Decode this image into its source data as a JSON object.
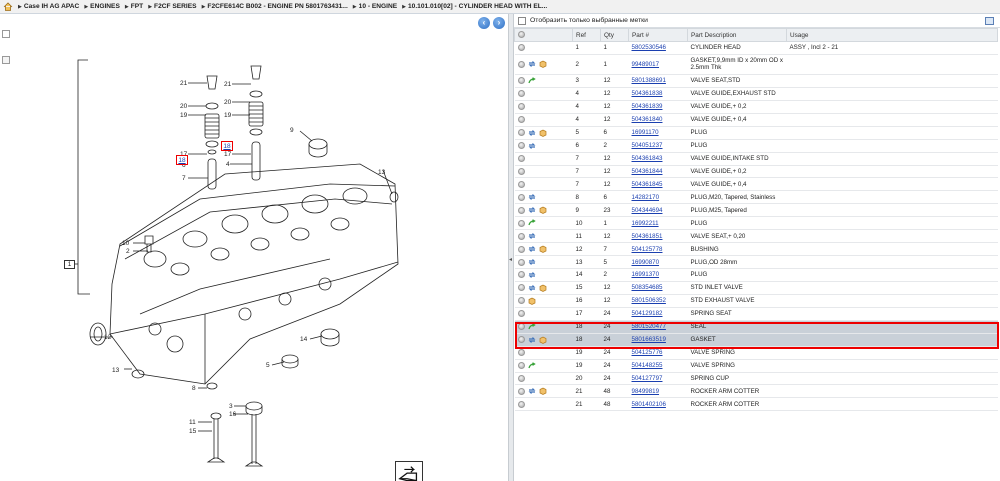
{
  "breadcrumb": {
    "items": [
      "Case IH AG APAC",
      "ENGINES",
      "FPT",
      "F2CF SERIES",
      "F2CFE614C B002 - ENGINE PN 5801763431...",
      "10 - ENGINE",
      "10.101.010[02] - CYLINDER HEAD WITH EL..."
    ]
  },
  "diagram": {
    "highlighted_callouts": [
      "18",
      "18"
    ],
    "group_label": "1",
    "callouts": [
      "21",
      "21",
      "20",
      "19",
      "20",
      "19",
      "17",
      "17",
      "7",
      "4",
      "9",
      "13",
      "14",
      "10",
      "2",
      "8",
      "12",
      "13",
      "5",
      "6",
      "3",
      "16",
      "11",
      "15",
      "14"
    ]
  },
  "parts_panel": {
    "filter_label": "Отобразить только выбранные метки",
    "columns": [
      "",
      "Ref",
      "Qty",
      "Part #",
      "Part Description",
      "Usage"
    ],
    "rows": [
      {
        "icons": [],
        "ref": "1",
        "qty": "1",
        "part": "5802530546",
        "desc": "CYLINDER HEAD",
        "usage": "ASSY , Incl 2 - 21"
      },
      {
        "icons": [
          "swap",
          "box"
        ],
        "ref": "2",
        "qty": "1",
        "part": "99489017",
        "desc": "GASKET,9,9mm ID x 20mm OD x 2.5mm Thk",
        "usage": ""
      },
      {
        "icons": [
          "arrow"
        ],
        "ref": "3",
        "qty": "12",
        "part": "5801388691",
        "desc": "VALVE SEAT,STD",
        "usage": ""
      },
      {
        "icons": [],
        "ref": "4",
        "qty": "12",
        "part": "504361838",
        "desc": "VALVE GUIDE,EXHAUST STD",
        "usage": ""
      },
      {
        "icons": [],
        "ref": "4",
        "qty": "12",
        "part": "504361839",
        "desc": "VALVE GUIDE,+ 0,2",
        "usage": ""
      },
      {
        "icons": [],
        "ref": "4",
        "qty": "12",
        "part": "504361840",
        "desc": "VALVE GUIDE,+ 0,4",
        "usage": ""
      },
      {
        "icons": [
          "swap",
          "box"
        ],
        "ref": "5",
        "qty": "6",
        "part": "16991170",
        "desc": "PLUG",
        "usage": ""
      },
      {
        "icons": [
          "swap"
        ],
        "ref": "6",
        "qty": "2",
        "part": "504051237",
        "desc": "PLUG",
        "usage": ""
      },
      {
        "icons": [],
        "ref": "7",
        "qty": "12",
        "part": "504361843",
        "desc": "VALVE GUIDE,INTAKE STD",
        "usage": ""
      },
      {
        "icons": [],
        "ref": "7",
        "qty": "12",
        "part": "504361844",
        "desc": "VALVE GUIDE,+ 0,2",
        "usage": ""
      },
      {
        "icons": [],
        "ref": "7",
        "qty": "12",
        "part": "504361845",
        "desc": "VALVE GUIDE,+ 0,4",
        "usage": ""
      },
      {
        "icons": [
          "swap"
        ],
        "ref": "8",
        "qty": "6",
        "part": "14282170",
        "desc": "PLUG,M20, Tapered, Stainless",
        "usage": ""
      },
      {
        "icons": [
          "swap",
          "box"
        ],
        "ref": "9",
        "qty": "23",
        "part": "504344694",
        "desc": "PLUG,M25, Tapered",
        "usage": ""
      },
      {
        "icons": [
          "arrow"
        ],
        "ref": "10",
        "qty": "1",
        "part": "16992211",
        "desc": "PLUG",
        "usage": ""
      },
      {
        "icons": [
          "swap"
        ],
        "ref": "11",
        "qty": "12",
        "part": "504361851",
        "desc": "VALVE SEAT,+ 0,20",
        "usage": ""
      },
      {
        "icons": [
          "swap",
          "box"
        ],
        "ref": "12",
        "qty": "7",
        "part": "504125778",
        "desc": "BUSHING",
        "usage": ""
      },
      {
        "icons": [
          "swap"
        ],
        "ref": "13",
        "qty": "5",
        "part": "16990870",
        "desc": "PLUG,OD 28mm",
        "usage": ""
      },
      {
        "icons": [
          "swap"
        ],
        "ref": "14",
        "qty": "2",
        "part": "16991370",
        "desc": "PLUG",
        "usage": ""
      },
      {
        "icons": [
          "swap",
          "box"
        ],
        "ref": "15",
        "qty": "12",
        "part": "508354685",
        "desc": "STD INLET VALVE",
        "usage": ""
      },
      {
        "icons": [
          "box"
        ],
        "ref": "16",
        "qty": "12",
        "part": "5801506352",
        "desc": "STD EXHAUST VALVE",
        "usage": ""
      },
      {
        "icons": [],
        "ref": "17",
        "qty": "24",
        "part": "504129182",
        "desc": "SPRING SEAT",
        "usage": ""
      },
      {
        "icons": [
          "arrow"
        ],
        "ref": "18",
        "qty": "24",
        "part": "5801520477",
        "desc": "SEAL",
        "usage": "",
        "selected": true
      },
      {
        "icons": [
          "swap",
          "box"
        ],
        "ref": "18",
        "qty": "24",
        "part": "5801663519",
        "desc": "GASKET",
        "usage": "",
        "selected": true
      },
      {
        "icons": [],
        "ref": "19",
        "qty": "24",
        "part": "504125776",
        "desc": "VALVE SPRING",
        "usage": ""
      },
      {
        "icons": [
          "arrow"
        ],
        "ref": "19",
        "qty": "24",
        "part": "504148255",
        "desc": "VALVE SPRING",
        "usage": ""
      },
      {
        "icons": [],
        "ref": "20",
        "qty": "24",
        "part": "504127797",
        "desc": "SPRING CUP",
        "usage": ""
      },
      {
        "icons": [
          "swap",
          "box"
        ],
        "ref": "21",
        "qty": "48",
        "part": "98499819",
        "desc": "ROCKER ARM COTTER",
        "usage": ""
      },
      {
        "icons": [],
        "ref": "21",
        "qty": "48",
        "part": "5801402106",
        "desc": "ROCKER ARM COTTER",
        "usage": ""
      }
    ]
  },
  "colors": {
    "accent": "#2e6fc4",
    "link": "#1a3fb0",
    "highlight": "#e00000",
    "selected_row": "#c9d0d8",
    "arrow_icon": "#3aa33a",
    "box_icon": "#e0a640"
  }
}
